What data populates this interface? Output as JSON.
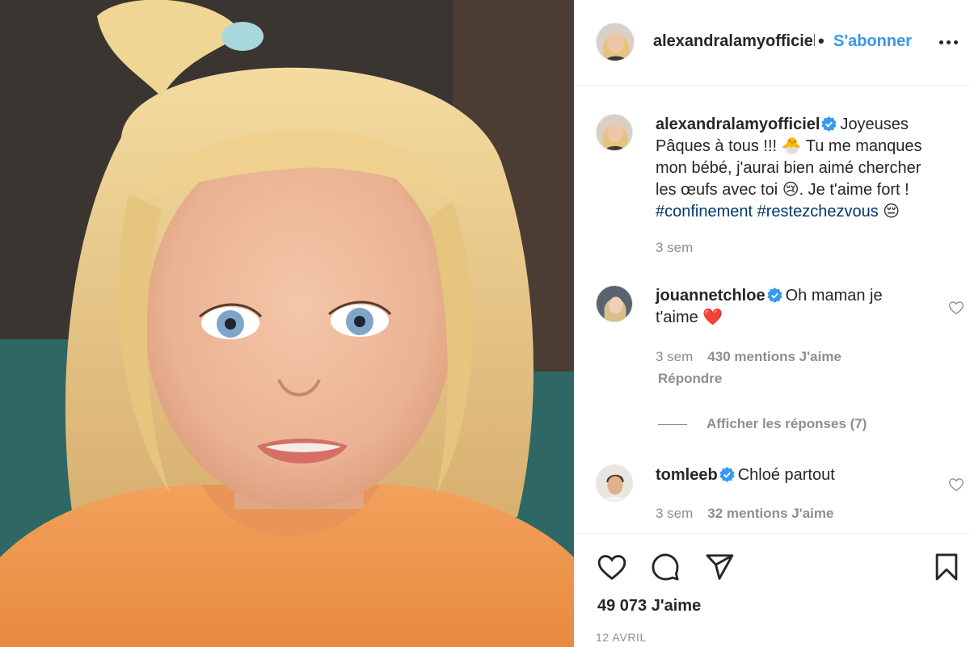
{
  "post": {
    "photo_alt": "photo-enfant",
    "author": "alexandralamyofficiel",
    "separator": "•",
    "follow_label": "S'abonner",
    "caption": {
      "username": "alexandralamyofficiel",
      "line1": "Joyeuses",
      "line2": "Pâques à tous !!! 🐣 Tu me manques",
      "line3": "mon bébé, j'aurai bien aimé chercher",
      "line4": "les œufs avec toi 😢. Je t'aime fort !",
      "hashtag1": "#confinement",
      "hashtag2": "#restezchezvous",
      "emoji_end": "😔",
      "time": "3 sem"
    },
    "comments": [
      {
        "username": "jouannetchloe",
        "text_line1": "Oh maman je",
        "text_line2": "t'aime ❤️",
        "time": "3 sem",
        "likes": "430 mentions J'aime",
        "reply_label": "Répondre",
        "view_replies": "Afficher les réponses (7)"
      },
      {
        "username": "tomleeb",
        "text_line1": "Chloé partout",
        "time": "3 sem",
        "likes": "32 mentions J'aime"
      }
    ],
    "likes_count": "49 073 J'aime",
    "date": "12 AVRIL"
  },
  "colors": {
    "accent": "#3897f0",
    "verified": "#3897f0",
    "secondary_text": "#8e8e8e",
    "hashtag": "#00376b"
  },
  "icons": [
    "more-options-icon",
    "verified-icon",
    "heart-icon",
    "comment-icon",
    "share-icon",
    "bookmark-icon"
  ]
}
